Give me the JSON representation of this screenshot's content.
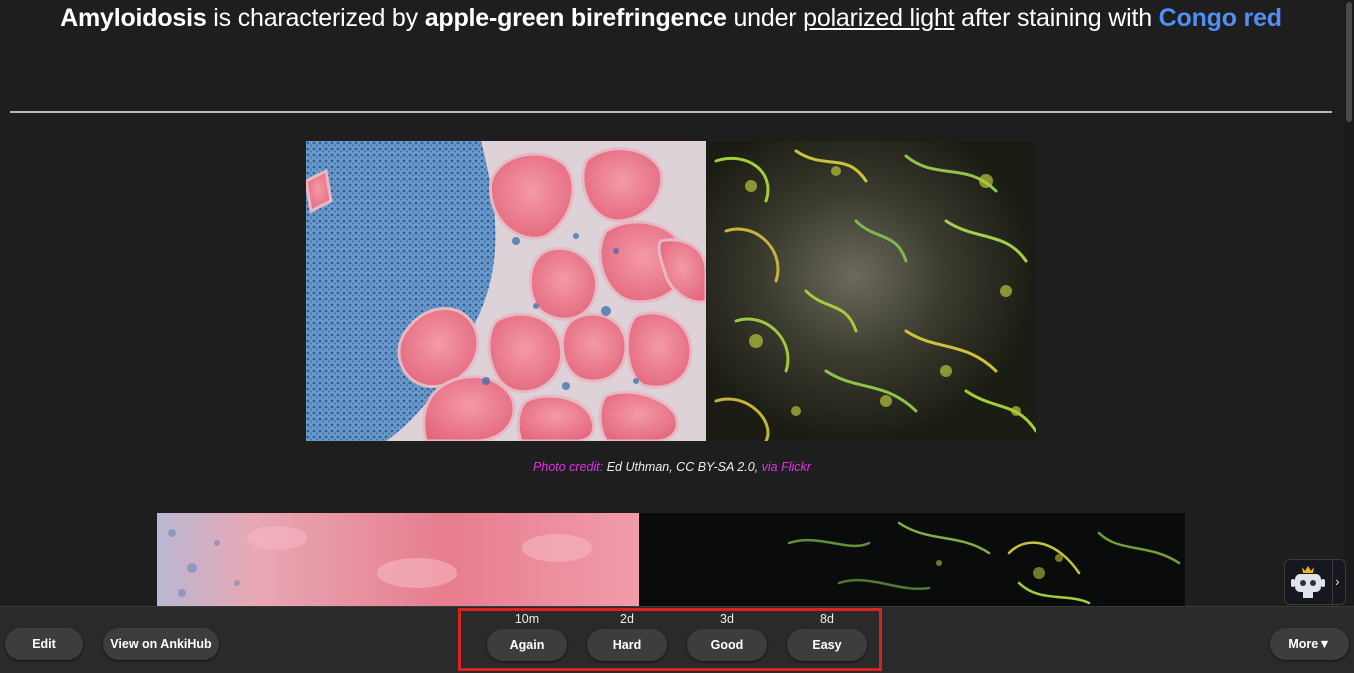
{
  "question": {
    "t1": "Amyloidosis",
    "t2": " is characterized by ",
    "t3": "apple-green birefringence",
    "t4": " under ",
    "t5": "polarized light",
    "t6": " after staining with ",
    "t7": "Congo red"
  },
  "credit": {
    "prefix": "Photo credit: ",
    "author": "Ed Uthman, CC BY-SA 2.0,",
    "suffix": " via Flickr"
  },
  "bottom_bar": {
    "edit_label": "Edit",
    "ankihub_label": "View on AnkiHub",
    "more_label": "More",
    "answers": [
      {
        "interval": "10m",
        "label": "Again"
      },
      {
        "interval": "2d",
        "label": "Hard"
      },
      {
        "interval": "3d",
        "label": "Good"
      },
      {
        "interval": "8d",
        "label": "Easy"
      }
    ]
  },
  "colors": {
    "background": "#1e1e1e",
    "congo_blue": "#4f8ff7",
    "credit_magenta": "#e12fe6",
    "highlight_red": "#d92323"
  },
  "icons": {
    "bot": "robot-crown-icon",
    "chevron": "chevron-right-icon",
    "more": "triangle-down-icon"
  }
}
